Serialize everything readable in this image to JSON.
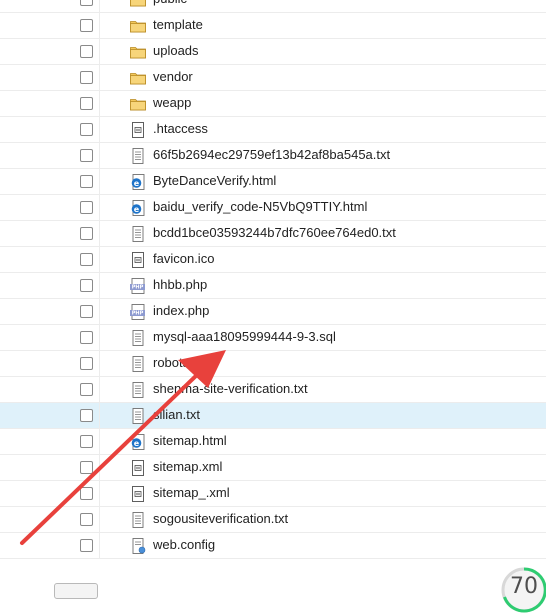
{
  "files": [
    {
      "name": "public",
      "type": "folder",
      "selected": false
    },
    {
      "name": "template",
      "type": "folder",
      "selected": false
    },
    {
      "name": "uploads",
      "type": "folder",
      "selected": false
    },
    {
      "name": "vendor",
      "type": "folder",
      "selected": false
    },
    {
      "name": "weapp",
      "type": "folder",
      "selected": false
    },
    {
      "name": ".htaccess",
      "type": "config",
      "selected": false
    },
    {
      "name": "66f5b2694ec29759ef13b42af8ba545a.txt",
      "type": "txt",
      "selected": false
    },
    {
      "name": "ByteDanceVerify.html",
      "type": "html",
      "selected": false
    },
    {
      "name": "baidu_verify_code-N5VbQ9TTIY.html",
      "type": "html",
      "selected": false
    },
    {
      "name": "bcdd1bce03593244b7dfc760ee764ed0.txt",
      "type": "txt",
      "selected": false
    },
    {
      "name": "favicon.ico",
      "type": "config",
      "selected": false
    },
    {
      "name": "hhbb.php",
      "type": "php",
      "selected": false
    },
    {
      "name": "index.php",
      "type": "php",
      "selected": false
    },
    {
      "name": "mysql-aaa18095999444-9-3.sql",
      "type": "txt",
      "selected": false
    },
    {
      "name": "robots.txt",
      "type": "txt",
      "selected": false
    },
    {
      "name": "shenma-site-verification.txt",
      "type": "txt",
      "selected": false
    },
    {
      "name": "silian.txt",
      "type": "txt",
      "selected": true
    },
    {
      "name": "sitemap.html",
      "type": "html",
      "selected": false
    },
    {
      "name": "sitemap.xml",
      "type": "config",
      "selected": false
    },
    {
      "name": "sitemap_.xml",
      "type": "config",
      "selected": false
    },
    {
      "name": "sogousiteverification.txt",
      "type": "txt",
      "selected": false
    },
    {
      "name": "web.config",
      "type": "webconfig",
      "selected": false
    }
  ],
  "icons": {
    "folder": "folder-icon",
    "config": "config-file-icon",
    "txt": "text-file-icon",
    "html": "html-file-icon",
    "php": "php-file-icon",
    "webconfig": "web-config-icon"
  },
  "colors": {
    "selected_row": "#dff1fa",
    "arrow": "#e8413c",
    "folder": "#f3c85b",
    "ie_blue": "#1f74c9",
    "score_ring": "#2ecc71"
  },
  "annotation": {
    "type": "red-arrow",
    "points_to": "mysql-aaa18095999444-9-3.sql"
  },
  "score": {
    "value": "70"
  }
}
